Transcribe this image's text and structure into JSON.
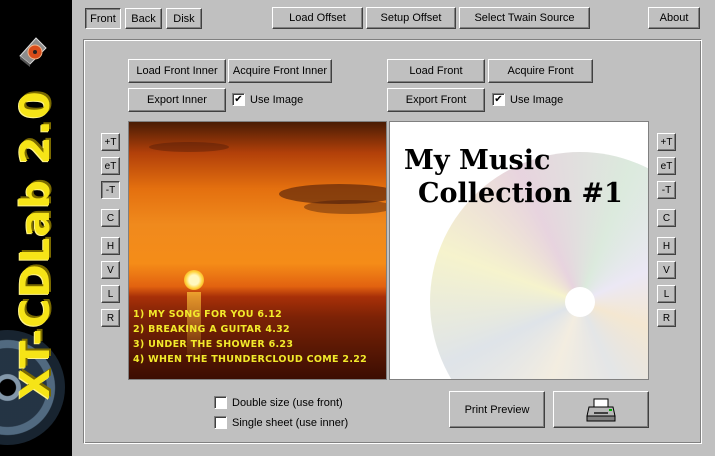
{
  "app": {
    "brand": "XT-CDLab 2.0"
  },
  "tabs": [
    {
      "label": "Front",
      "active": true
    },
    {
      "label": "Back",
      "active": false
    },
    {
      "label": "Disk",
      "active": false
    }
  ],
  "toolbar": {
    "load_offset": "Load Offset",
    "setup_offset": "Setup Offset",
    "select_twain": "Select Twain Source",
    "about": "About"
  },
  "inner": {
    "load": "Load Front Inner",
    "acquire": "Acquire Front Inner",
    "export": "Export Inner",
    "use_image": "Use Image",
    "use_image_checked": true
  },
  "front": {
    "load": "Load Front",
    "acquire": "Acquire Front",
    "export": "Export Front",
    "use_image": "Use Image",
    "use_image_checked": true
  },
  "left_tools": [
    "+T",
    "eT",
    "-T",
    "C",
    "H",
    "V",
    "L",
    "R"
  ],
  "right_tools": [
    "+T",
    "eT",
    "-T",
    "C",
    "H",
    "V",
    "L",
    "R"
  ],
  "inner_cover": {
    "tracks": [
      "1) My song for you 6.12",
      "2) Breaking a guitar 4.32",
      "3) Under the shower 6.23",
      "4) When the thundercloud come 2.22"
    ]
  },
  "front_cover": {
    "title_line1": "My Music",
    "title_line2": "Collection #1"
  },
  "options": {
    "double_size": "Double size (use front)",
    "double_size_checked": false,
    "single_sheet": "Single sheet (use inner)",
    "single_sheet_checked": false
  },
  "print_preview": "Print Preview",
  "colors": {
    "brand_yellow": "#f6e417",
    "face": "#c0c0c0"
  },
  "icons": {
    "print": "printer-icon",
    "logo": "cd-logo-icon"
  }
}
